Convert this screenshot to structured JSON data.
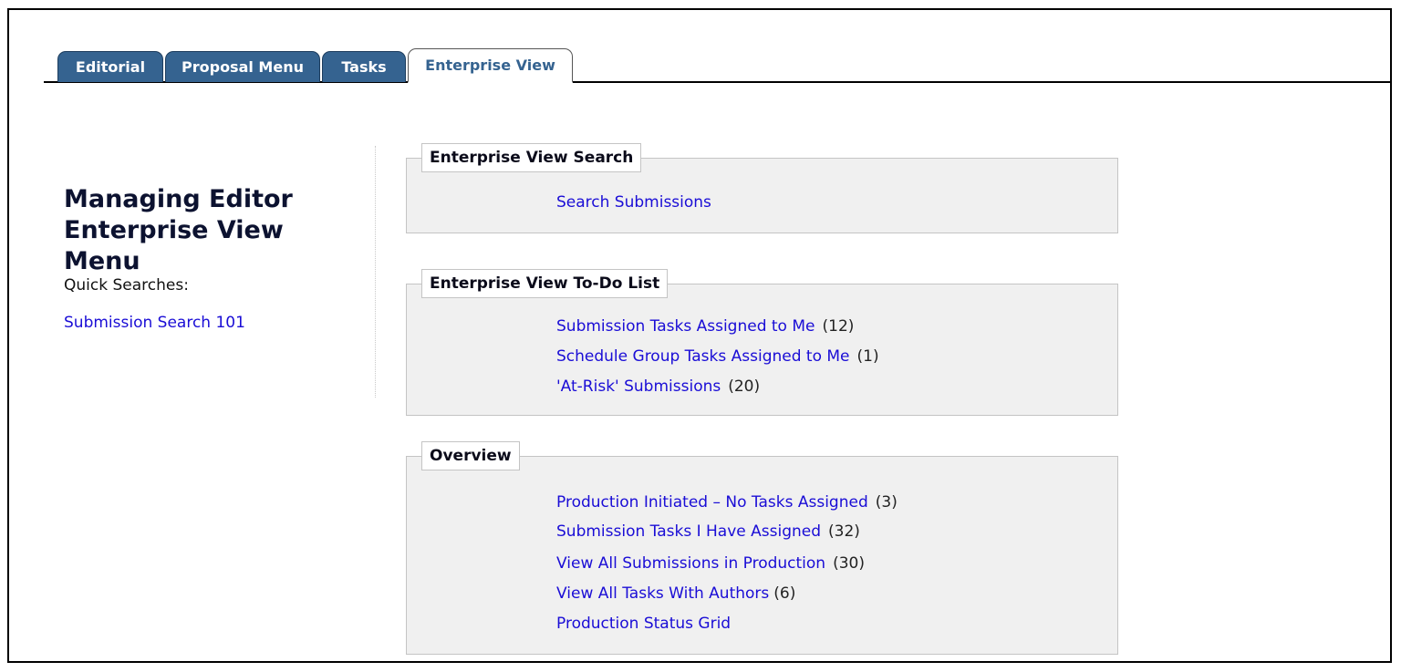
{
  "tabs": [
    {
      "label": "Editorial"
    },
    {
      "label": "Proposal Menu"
    },
    {
      "label": "Tasks"
    },
    {
      "label": "Enterprise View"
    }
  ],
  "sidebar": {
    "title_line1": "Managing Editor",
    "title_line2": "Enterprise View Menu",
    "quick_searches_label": "Quick Searches:",
    "quick_link": "Submission Search 101"
  },
  "panels": {
    "search": {
      "legend": "Enterprise View Search",
      "items": [
        {
          "label": "Search Submissions",
          "count": ""
        }
      ]
    },
    "todo": {
      "legend": "Enterprise View To-Do List",
      "items": [
        {
          "label": "Submission Tasks Assigned to Me",
          "count": "(12)"
        },
        {
          "label": "Schedule Group Tasks Assigned to Me",
          "count": "(1)"
        },
        {
          "label": "'At-Risk' Submissions",
          "count": "(20)"
        }
      ]
    },
    "overview": {
      "legend": "Overview",
      "items": [
        {
          "label": "Production Initiated – No Tasks Assigned",
          "count": "(3)"
        },
        {
          "label": "Submission Tasks I Have Assigned",
          "count": "(32)"
        },
        {
          "label": "View All Submissions in Production",
          "count": "(30)"
        },
        {
          "label": "View All Tasks With Authors",
          "count": "(6)"
        },
        {
          "label": "Production Status Grid",
          "count": ""
        }
      ]
    }
  },
  "colors": {
    "tab_blue": "#356390",
    "link_blue": "#1a0dd6",
    "panel_bg": "#f0f0f0"
  }
}
